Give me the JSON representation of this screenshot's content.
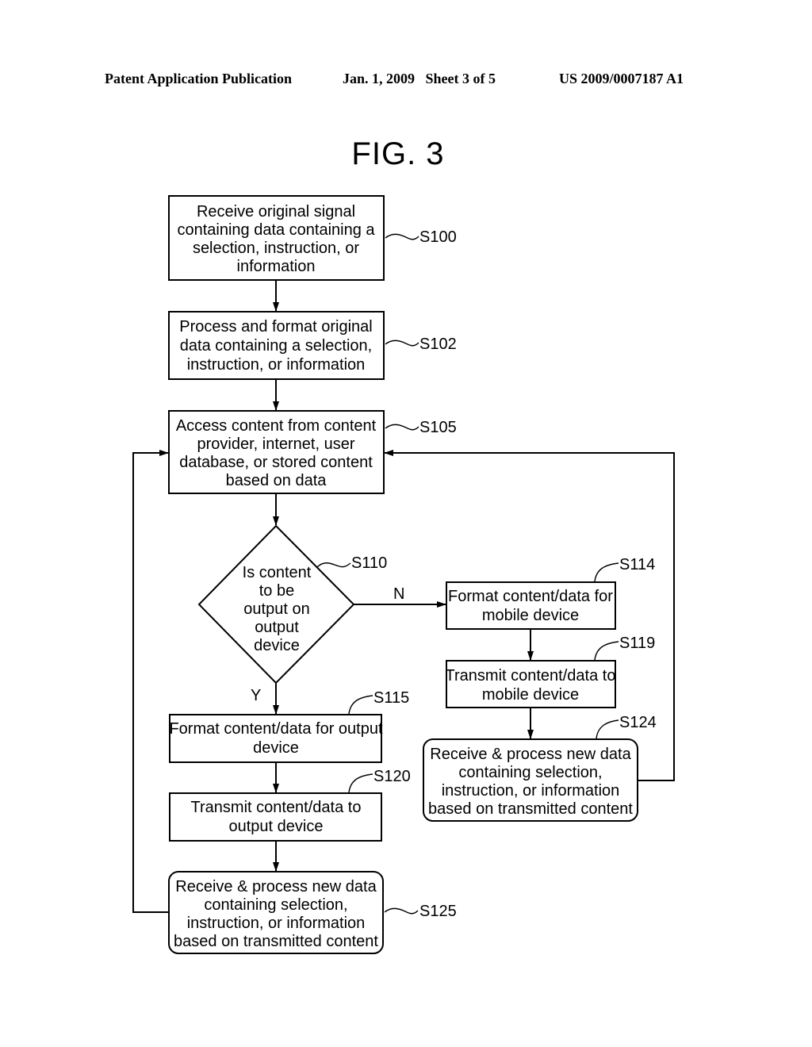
{
  "header": {
    "publication": "Patent Application Publication",
    "date_sheet": "Jan. 1, 2009   Sheet 3 of 5",
    "patent_number": "US 2009/0007187 A1"
  },
  "figure": {
    "title": "FIG. 3",
    "steps": {
      "s100": {
        "ref": "S100",
        "lines": [
          "Receive original signal",
          "containing data containing a",
          "selection, instruction, or",
          "information"
        ]
      },
      "s102": {
        "ref": "S102",
        "lines": [
          "Process and format original",
          "data containing a selection,",
          "instruction, or information"
        ]
      },
      "s105": {
        "ref": "S105",
        "lines": [
          "Access content from content",
          "provider, internet, user",
          "database, or stored content",
          "based on data"
        ]
      },
      "s110": {
        "ref": "S110",
        "lines": [
          "Is content",
          "to be",
          "output on",
          "output",
          "device"
        ]
      },
      "s114": {
        "ref": "S114",
        "lines": [
          "Format content/data for",
          "mobile device"
        ]
      },
      "s119": {
        "ref": "S119",
        "lines": [
          "Transmit content/data to",
          "mobile device"
        ]
      },
      "s124": {
        "ref": "S124",
        "lines": [
          "Receive & process new data",
          "containing selection,",
          "instruction, or information",
          "based on transmitted content"
        ]
      },
      "s115": {
        "ref": "S115",
        "lines": [
          "Format content/data for output",
          "device"
        ]
      },
      "s120": {
        "ref": "S120",
        "lines": [
          "Transmit content/data to",
          "output device"
        ]
      },
      "s125": {
        "ref": "S125",
        "lines": [
          "Receive & process new data",
          "containing selection,",
          "instruction, or information",
          "based on transmitted content"
        ]
      }
    },
    "branch_labels": {
      "no": "N",
      "yes": "Y"
    }
  }
}
